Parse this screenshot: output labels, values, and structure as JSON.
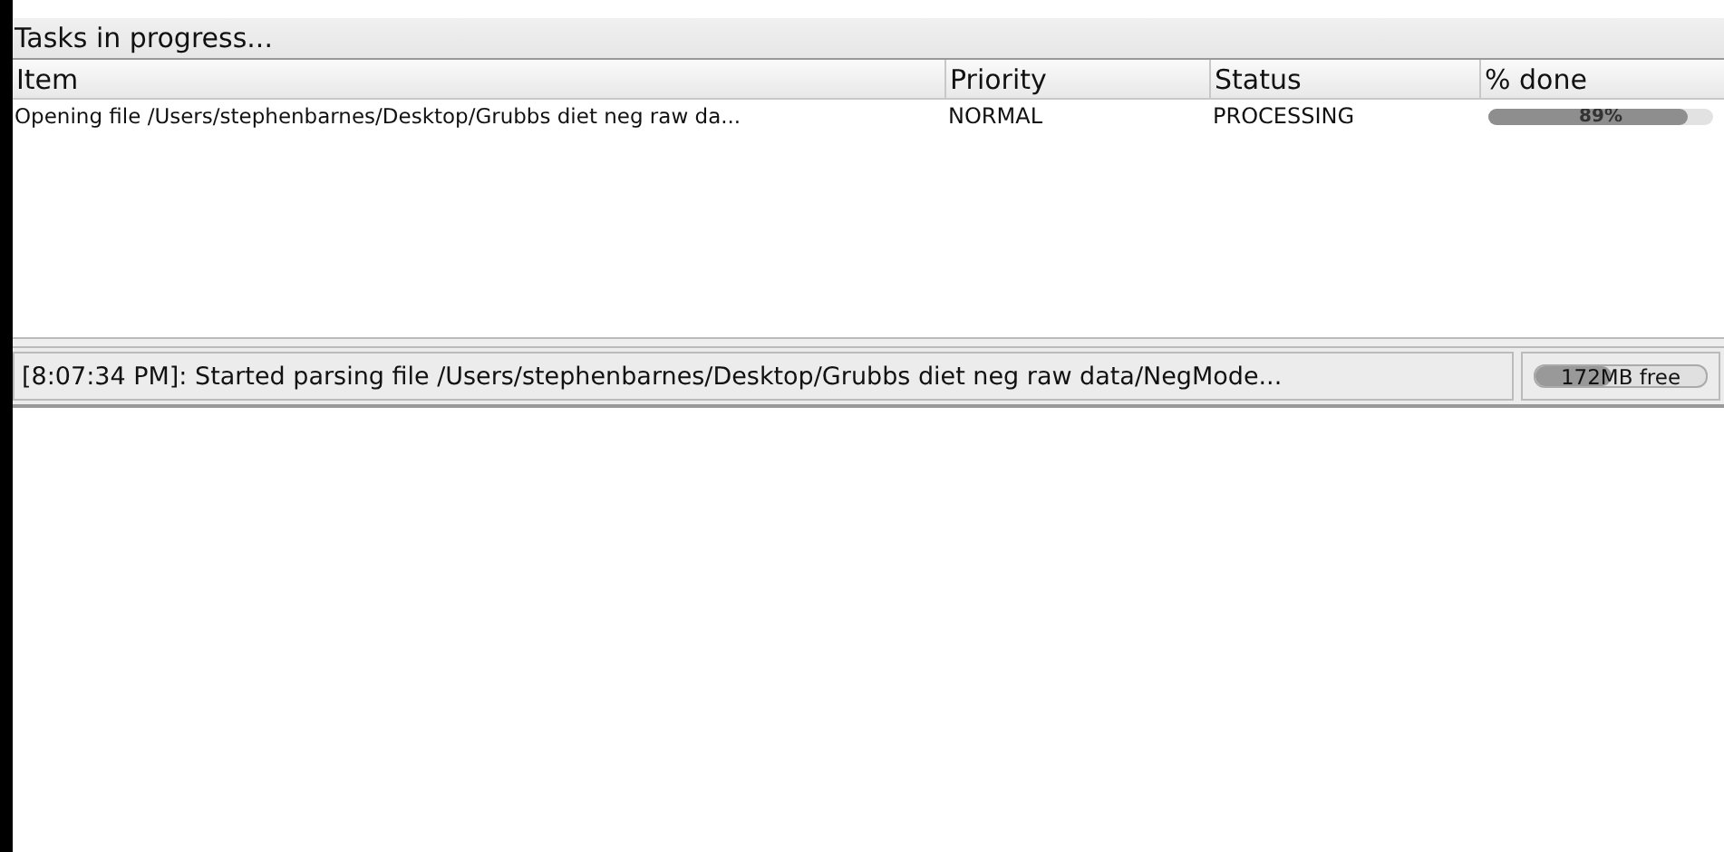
{
  "panel": {
    "title": "Tasks in progress..."
  },
  "table": {
    "columns": [
      "Item",
      "Priority",
      "Status",
      "% done"
    ],
    "rows": [
      {
        "item": "Opening file /Users/stephenbarnes/Desktop/Grubbs diet neg raw da...",
        "priority": "NORMAL",
        "status": "PROCESSING",
        "progress_label": "89%",
        "level": 0.89
      }
    ]
  },
  "status_bar": {
    "message": "[8:07:34 PM]: Started parsing file /Users/stephenbarnes/Desktop/Grubbs diet neg raw data/NegMode...",
    "memory": {
      "label": "172MB free",
      "level": 0.45
    }
  }
}
